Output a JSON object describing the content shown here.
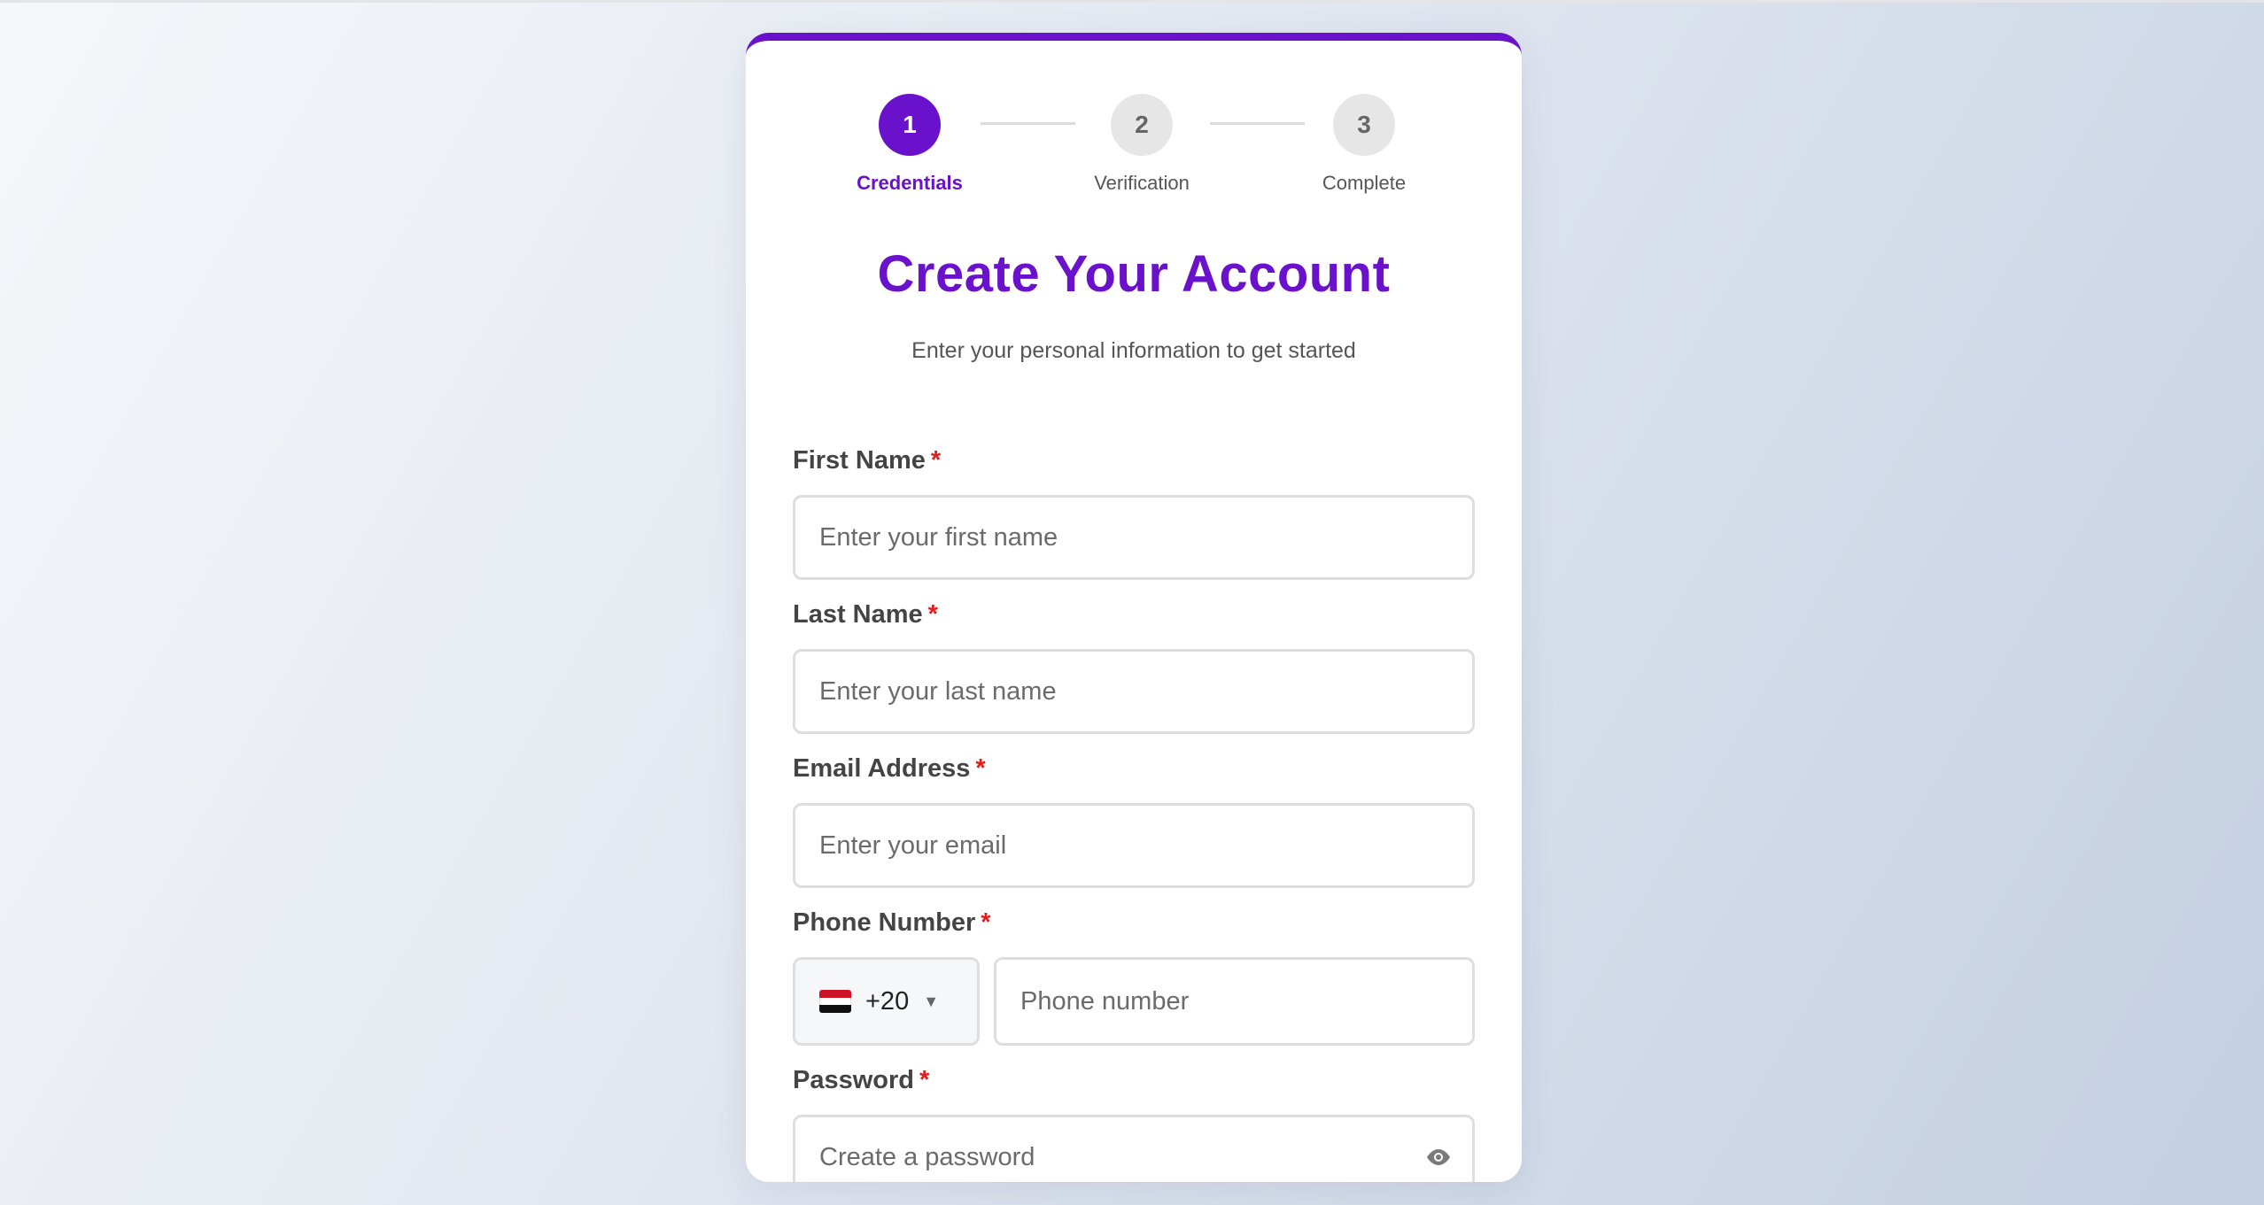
{
  "stepper": {
    "steps": [
      {
        "number": "1",
        "label": "Credentials",
        "state": "active"
      },
      {
        "number": "2",
        "label": "Verification",
        "state": "inactive"
      },
      {
        "number": "3",
        "label": "Complete",
        "state": "inactive"
      }
    ]
  },
  "header": {
    "title": "Create Your Account",
    "subtitle": "Enter your personal information to get started"
  },
  "form": {
    "required_marker": "*",
    "first_name": {
      "label": "First Name",
      "placeholder": "Enter your first name",
      "value": ""
    },
    "last_name": {
      "label": "Last Name",
      "placeholder": "Enter your last name",
      "value": ""
    },
    "email": {
      "label": "Email Address",
      "placeholder": "Enter your email",
      "value": ""
    },
    "phone": {
      "label": "Phone Number",
      "country_code": "+20",
      "country_flag": "egypt-flag-icon",
      "caret": "▼",
      "placeholder": "Phone number",
      "value": ""
    },
    "password": {
      "label": "Password",
      "placeholder": "Create a password",
      "value": "",
      "toggle_icon": "eye-icon"
    }
  },
  "colors": {
    "accent": "#6a11cb",
    "required": "#e21b1b",
    "inactive_step": "#e6e6e6"
  }
}
